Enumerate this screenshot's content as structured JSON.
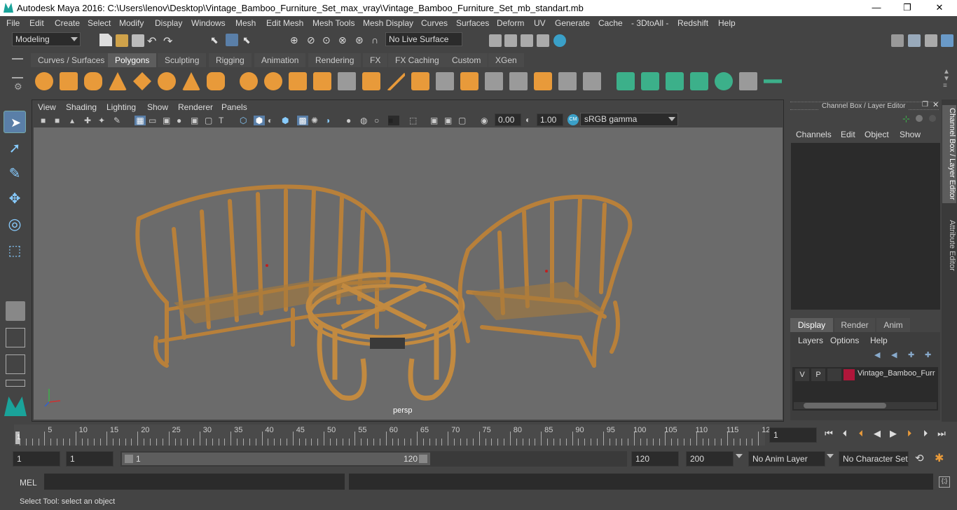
{
  "window": {
    "title": "Autodesk Maya 2016: C:\\Users\\lenov\\Desktop\\Vintage_Bamboo_Furniture_Set_max_vray\\Vintage_Bamboo_Furniture_Set_mb_standart.mb",
    "minimize": "—",
    "restore": "❐",
    "close": "✕"
  },
  "menubar": [
    "File",
    "Edit",
    "Create",
    "Select",
    "Modify",
    "Display",
    "Windows",
    "Mesh",
    "Edit Mesh",
    "Mesh Tools",
    "Mesh Display",
    "Curves",
    "Surfaces",
    "Deform",
    "UV",
    "Generate",
    "Cache",
    "- 3DtoAll -",
    "Redshift",
    "Help"
  ],
  "statusline": {
    "mode": "Modeling",
    "live_surface": "No Live Surface"
  },
  "shelf_tabs": [
    "Curves / Surfaces",
    "Polygons",
    "Sculpting",
    "Rigging",
    "Animation",
    "Rendering",
    "FX",
    "FX Caching",
    "Custom",
    "XGen"
  ],
  "shelf_active": "Polygons",
  "viewport": {
    "menu": [
      "View",
      "Shading",
      "Lighting",
      "Show",
      "Renderer",
      "Panels"
    ],
    "exposure": "0.00",
    "gamma": "1.00",
    "color_space": "sRGB gamma",
    "camera_label": "persp"
  },
  "channel_box": {
    "title": "Channel Box / Layer Editor",
    "menu": [
      "Channels",
      "Edit",
      "Object",
      "Show"
    ]
  },
  "layer_editor": {
    "tabs": [
      "Display",
      "Render",
      "Anim"
    ],
    "active_tab": "Display",
    "menu": [
      "Layers",
      "Options",
      "Help"
    ],
    "layer": {
      "v": "V",
      "p": "P",
      "name": "Vintage_Bamboo_Furr",
      "color": "#b0163a"
    }
  },
  "side_tabs": [
    "Channel Box / Layer Editor",
    "Attribute Editor"
  ],
  "timeline": {
    "ticks": [
      "5",
      "10",
      "15",
      "20",
      "25",
      "30",
      "35",
      "40",
      "45",
      "50",
      "55",
      "60",
      "65",
      "70",
      "75",
      "80",
      "85",
      "90",
      "95",
      "100",
      "105",
      "110",
      "115",
      "12"
    ],
    "current_frame": "1",
    "start_marker": "1"
  },
  "range": {
    "start": "1",
    "playback_start": "1",
    "slider_start": "1",
    "slider_end": "120",
    "playback_end": "120",
    "end": "200",
    "anim_layer": "No Anim Layer",
    "character_set": "No Character Set"
  },
  "cmdline": {
    "label": "MEL"
  },
  "helpline": {
    "text": "Select Tool: select an object"
  }
}
